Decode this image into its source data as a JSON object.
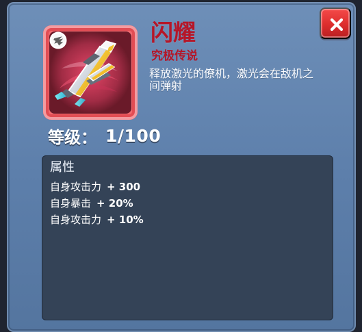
{
  "colors": {
    "panel": "#6485b0",
    "title": "#b51628",
    "attributes_box": "#344357",
    "close_button": "#e23333",
    "icon_frame": "#f06a6f"
  },
  "dialog": {
    "close_label": "✖",
    "title": "闪耀",
    "rarity": "究极传说",
    "description": "释放激光的僚机，激光会在敌机之间弹射",
    "level_label": "等级：",
    "level_value": "1/100",
    "badge_icon": "wing-badge-icon",
    "item_icon": "jet-fighter-icon"
  },
  "attributes": {
    "title": "属性",
    "items": [
      {
        "name": "自身攻击力",
        "value": "+ 300"
      },
      {
        "name": "自身暴击",
        "value": "+ 20%"
      },
      {
        "name": "自身攻击力",
        "value": "+ 10%"
      }
    ]
  }
}
